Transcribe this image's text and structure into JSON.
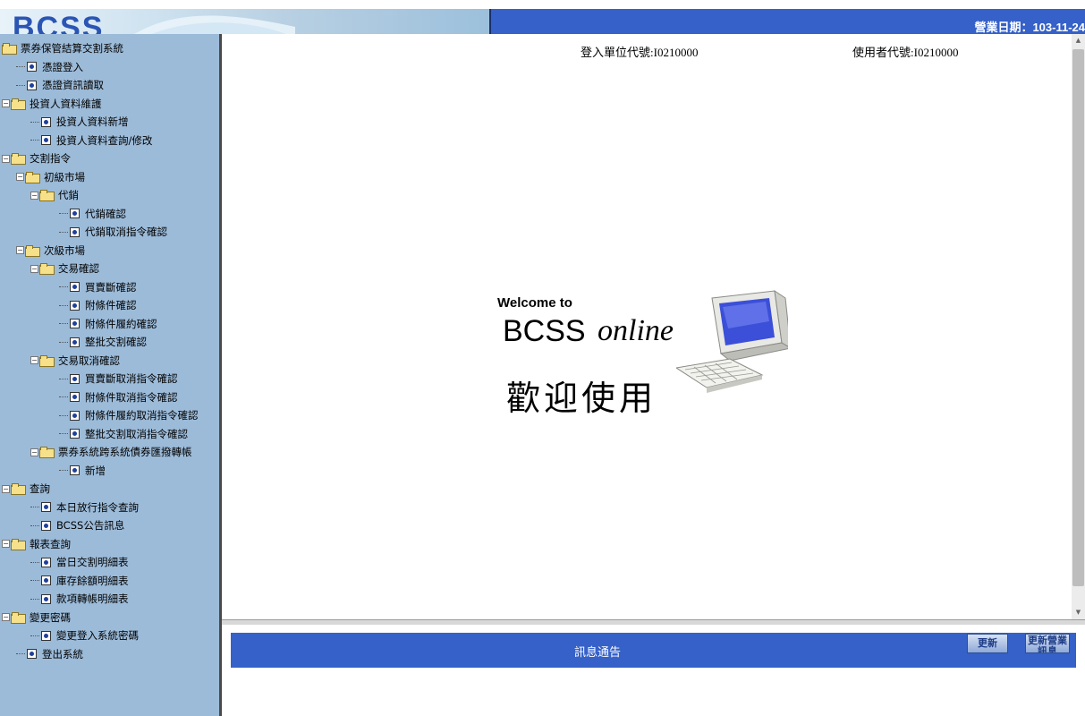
{
  "header": {
    "logo_text": "BCSS",
    "business_date": "營業日期：103-11-24"
  },
  "sidebar": {
    "items": [
      {
        "label": "票券保管結算交割系統",
        "type": "folder",
        "indent": 0,
        "expander": ""
      },
      {
        "label": "憑證登入",
        "type": "doc",
        "indent": 1
      },
      {
        "label": "憑證資訊讀取",
        "type": "doc",
        "indent": 1
      },
      {
        "label": "投資人資料維護",
        "type": "folder",
        "indent": 0,
        "expander": "−"
      },
      {
        "label": "投資人資料新增",
        "type": "doc",
        "indent": 2
      },
      {
        "label": "投資人資料查詢/修改",
        "type": "doc",
        "indent": 2
      },
      {
        "label": "交割指令",
        "type": "folder",
        "indent": 0,
        "expander": "−"
      },
      {
        "label": "初級市場",
        "type": "folder",
        "indent": 1,
        "expander": "−"
      },
      {
        "label": "代銷",
        "type": "folder",
        "indent": 2,
        "expander": "−"
      },
      {
        "label": "代銷確認",
        "type": "doc",
        "indent": 4
      },
      {
        "label": "代銷取消指令確認",
        "type": "doc",
        "indent": 4
      },
      {
        "label": "次級市場",
        "type": "folder",
        "indent": 1,
        "expander": "−"
      },
      {
        "label": "交易確認",
        "type": "folder",
        "indent": 2,
        "expander": "−"
      },
      {
        "label": "買賣斷確認",
        "type": "doc",
        "indent": 4
      },
      {
        "label": "附條件確認",
        "type": "doc",
        "indent": 4
      },
      {
        "label": "附條件履約確認",
        "type": "doc",
        "indent": 4
      },
      {
        "label": "整批交割確認",
        "type": "doc",
        "indent": 4
      },
      {
        "label": "交易取消確認",
        "type": "folder",
        "indent": 2,
        "expander": "−"
      },
      {
        "label": "買賣斷取消指令確認",
        "type": "doc",
        "indent": 4
      },
      {
        "label": "附條件取消指令確認",
        "type": "doc",
        "indent": 4
      },
      {
        "label": "附條件履約取消指令確認",
        "type": "doc",
        "indent": 4
      },
      {
        "label": "整批交割取消指令確認",
        "type": "doc",
        "indent": 4
      },
      {
        "label": "票券系統跨系統債券匯撥轉帳",
        "type": "folder",
        "indent": 2,
        "expander": "−"
      },
      {
        "label": "新增",
        "type": "doc",
        "indent": 4
      },
      {
        "label": "查詢",
        "type": "folder",
        "indent": 0,
        "expander": "−"
      },
      {
        "label": "本日放行指令查詢",
        "type": "doc",
        "indent": 2
      },
      {
        "label": "BCSS公告訊息",
        "type": "doc",
        "indent": 2
      },
      {
        "label": "報表查詢",
        "type": "folder",
        "indent": 0,
        "expander": "−"
      },
      {
        "label": "當日交割明細表",
        "type": "doc",
        "indent": 2
      },
      {
        "label": "庫存餘額明細表",
        "type": "doc",
        "indent": 2
      },
      {
        "label": "款項轉帳明細表",
        "type": "doc",
        "indent": 2
      },
      {
        "label": "變更密碼",
        "type": "folder",
        "indent": 0,
        "expander": "−"
      },
      {
        "label": "變更登入系統密碼",
        "type": "doc",
        "indent": 2
      },
      {
        "label": "登出系統",
        "type": "doc",
        "indent": 1
      }
    ]
  },
  "main": {
    "login_unit": "登入單位代號:I0210000",
    "user_code": "使用者代號:I0210000",
    "welcome_to": "Welcome to",
    "bcss": "BCSS",
    "online": "online",
    "huanying": "歡迎使用"
  },
  "notice": {
    "title": "訊息通告",
    "refresh_label": "更新",
    "refresh_msg_label": "更新營業訊息"
  },
  "colors": {
    "banner_blue": "#3561c8",
    "sidebar_bg": "#9cbbd9"
  }
}
